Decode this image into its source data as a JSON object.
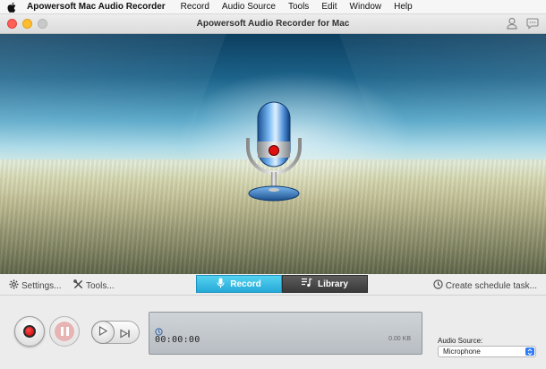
{
  "menubar": {
    "app_name": "Apowersoft Mac Audio Recorder",
    "items": [
      "Record",
      "Audio Source",
      "Tools",
      "Edit",
      "Window",
      "Help"
    ]
  },
  "window": {
    "title": "Apowersoft Audio Recorder for Mac"
  },
  "toolbar": {
    "settings_label": "Settings...",
    "tools_label": "Tools...",
    "record_tab": "Record",
    "library_tab": "Library",
    "schedule_label": "Create schedule task..."
  },
  "status": {
    "timer": "00:00:00",
    "file_size": "0.00 KB"
  },
  "audio_source": {
    "label": "Audio Source:",
    "selected": "Microphone"
  },
  "colors": {
    "record_tab": "#2fb4e0",
    "library_tab": "#454545",
    "record_dot": "#d40000",
    "select_arrow": "#2e7cf6"
  },
  "icons": [
    "apple-icon",
    "user-icon",
    "chat-icon",
    "microphone-icon",
    "gear-icon",
    "tools-icon",
    "music-list-icon",
    "clock-icon",
    "record-icon",
    "pause-icon",
    "play-icon",
    "skip-forward-icon"
  ]
}
